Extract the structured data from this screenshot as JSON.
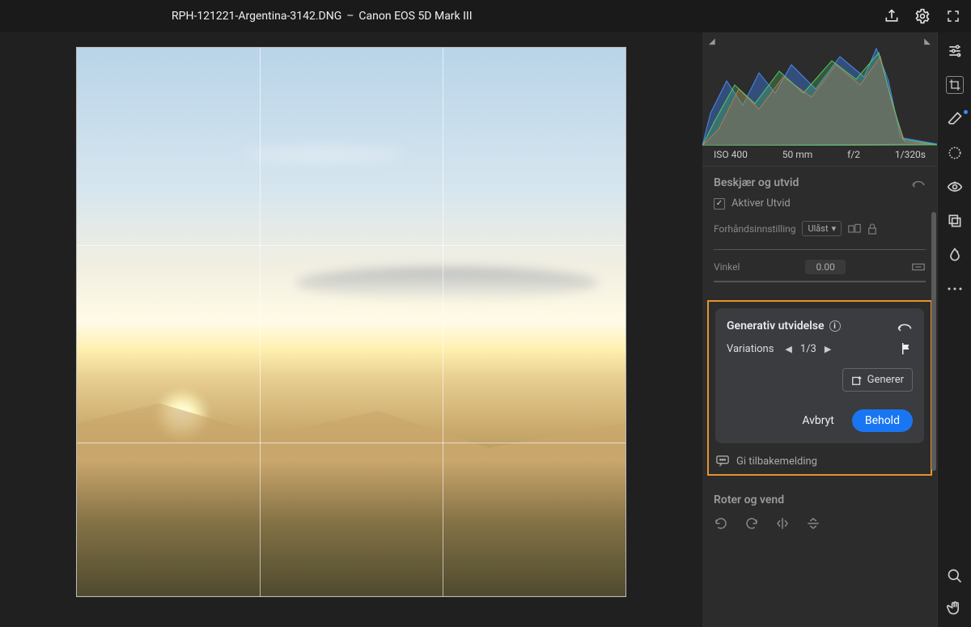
{
  "header": {
    "filename": "RPH-121221-Argentina-3142.DNG",
    "separator": "–",
    "camera": "Canon EOS 5D Mark III"
  },
  "meta": {
    "iso": "ISO 400",
    "focal": "50 mm",
    "aperture": "f/2",
    "shutter": "1/320s"
  },
  "crop_panel": {
    "title": "Beskjær og utvid",
    "enable_label": "Aktiver Utvid",
    "preset_label": "Forhåndsinnstilling",
    "preset_value": "Ulåst",
    "angle_label": "Vinkel",
    "angle_value": "0.00"
  },
  "gen_panel": {
    "title": "Generativ utvidelse",
    "variations_label": "Variations",
    "variation_counter": "1/3",
    "generate_label": "Generer",
    "cancel_label": "Avbryt",
    "keep_label": "Behold",
    "feedback_label": "Gi tilbakemelding"
  },
  "rotate_panel": {
    "title": "Roter og vend"
  }
}
